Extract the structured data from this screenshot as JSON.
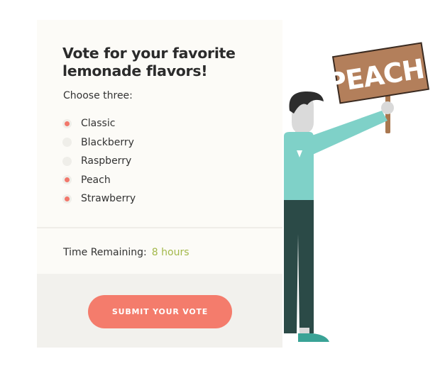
{
  "poll": {
    "title": "Vote for your favorite lemonade flavors!",
    "instruction": "Choose three:",
    "options": [
      {
        "label": "Classic",
        "checked": true
      },
      {
        "label": "Blackberry",
        "checked": false
      },
      {
        "label": "Raspberry",
        "checked": false
      },
      {
        "label": "Peach",
        "checked": true
      },
      {
        "label": "Strawberry",
        "checked": true
      }
    ],
    "time_label": "Time Remaining:",
    "time_value": "8 hours",
    "submit_label": "SUBMIT YOUR VOTE"
  },
  "illustration": {
    "sign_text": "PEACH!"
  },
  "colors": {
    "accent": "#f47c6c",
    "radio_selected": "#f2776b",
    "time_value": "#a3b84a",
    "card_bg": "#fcfbf7",
    "footer_bg": "#f2f1ed",
    "shirt": "#7fd1c8",
    "pants": "#2b4a47",
    "sign": "#b37f5b"
  }
}
